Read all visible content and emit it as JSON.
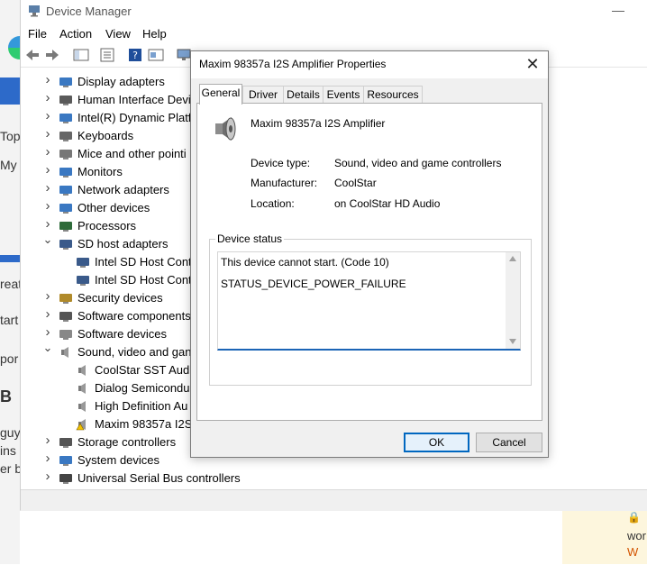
{
  "device_manager": {
    "title": "Device Manager",
    "minimize_glyph": "—",
    "menu": [
      "File",
      "Action",
      "View",
      "Help"
    ],
    "tree": [
      {
        "label": "Display adapters",
        "expanded": false,
        "icon": "display-adapter-icon"
      },
      {
        "label": "Human Interface Devic",
        "expanded": false,
        "icon": "hid-icon"
      },
      {
        "label": "Intel(R) Dynamic Platfo",
        "expanded": false,
        "icon": "platform-icon"
      },
      {
        "label": "Keyboards",
        "expanded": false,
        "icon": "keyboard-icon"
      },
      {
        "label": "Mice and other pointi",
        "expanded": false,
        "icon": "mouse-icon"
      },
      {
        "label": "Monitors",
        "expanded": false,
        "icon": "monitor-icon"
      },
      {
        "label": "Network adapters",
        "expanded": false,
        "icon": "network-icon"
      },
      {
        "label": "Other devices",
        "expanded": false,
        "icon": "other-devices-icon"
      },
      {
        "label": "Processors",
        "expanded": false,
        "icon": "processor-icon"
      },
      {
        "label": "SD host adapters",
        "expanded": true,
        "icon": "sd-host-icon"
      },
      {
        "label": "Intel SD Host Cont",
        "child": true,
        "icon": "sd-device-icon"
      },
      {
        "label": "Intel SD Host Cont",
        "child": true,
        "icon": "sd-device-icon"
      },
      {
        "label": "Security devices",
        "expanded": false,
        "icon": "security-icon"
      },
      {
        "label": "Software components",
        "expanded": false,
        "icon": "software-components-icon"
      },
      {
        "label": "Software devices",
        "expanded": false,
        "icon": "software-devices-icon"
      },
      {
        "label": "Sound, video and gan",
        "expanded": true,
        "icon": "speaker-icon"
      },
      {
        "label": "CoolStar SST Audi",
        "child": true,
        "icon": "speaker-icon"
      },
      {
        "label": "Dialog Semicondu",
        "child": true,
        "icon": "speaker-icon"
      },
      {
        "label": "High Definition Au",
        "child": true,
        "icon": "speaker-icon"
      },
      {
        "label": "Maxim 98357a I2S",
        "child": true,
        "icon": "speaker-warning-icon"
      },
      {
        "label": "Storage controllers",
        "expanded": false,
        "icon": "storage-icon"
      },
      {
        "label": "System devices",
        "expanded": false,
        "icon": "system-icon"
      },
      {
        "label": "Universal Serial Bus controllers",
        "expanded": false,
        "icon": "usb-icon"
      }
    ]
  },
  "background": {
    "left_fragments": [
      "Topi",
      "My f",
      "reat",
      "tart",
      "por",
      "B",
      "guy",
      "ins",
      "er b"
    ],
    "right_fragments": [
      "wor",
      "W"
    ]
  },
  "dialog": {
    "title": "Maxim 98357a I2S Amplifier Properties",
    "close_glyph": "✕",
    "tabs": [
      "General",
      "Driver",
      "Details",
      "Events",
      "Resources"
    ],
    "active_tab": "General",
    "device_name": "Maxim 98357a I2S Amplifier",
    "props": [
      {
        "label": "Device type:",
        "value": "Sound, video and game controllers"
      },
      {
        "label": "Manufacturer:",
        "value": "CoolStar"
      },
      {
        "label": "Location:",
        "value": "on CoolStar HD Audio"
      }
    ],
    "status_group_label": "Device status",
    "status_lines": [
      "This device cannot start. (Code 10)",
      "STATUS_DEVICE_POWER_FAILURE"
    ],
    "ok_label": "OK",
    "cancel_label": "Cancel"
  }
}
